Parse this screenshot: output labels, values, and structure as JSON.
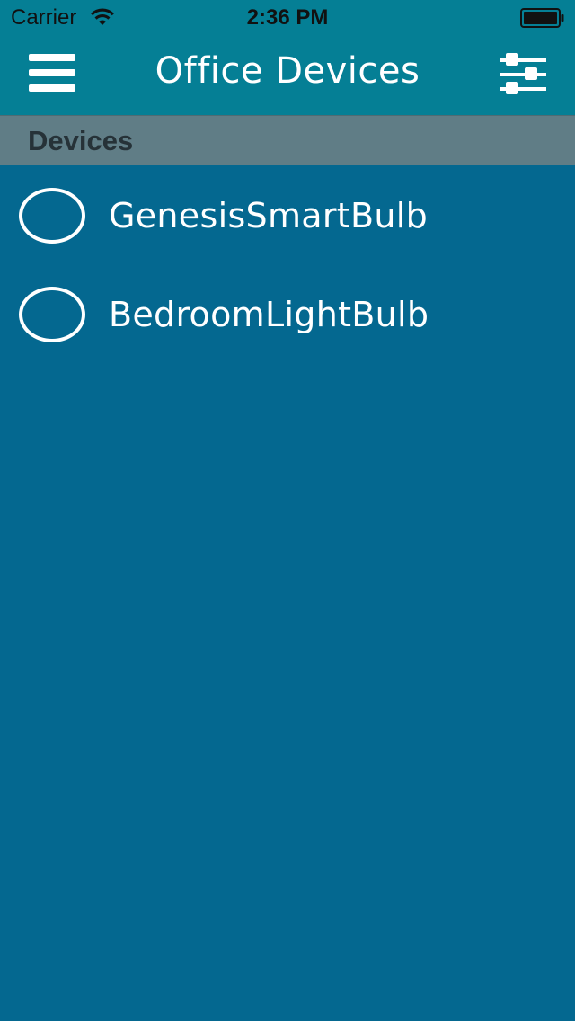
{
  "status_bar": {
    "carrier": "Carrier",
    "time": "2:36 PM",
    "wifi_icon": "wifi-icon",
    "battery_icon": "battery-icon"
  },
  "nav": {
    "title": "Office Devices",
    "menu_icon": "hamburger-menu-icon",
    "filter_icon": "sliders-icon"
  },
  "section": {
    "label": "Devices"
  },
  "devices": [
    {
      "name": "GenesisSmartBulb",
      "selected": false
    },
    {
      "name": "BedroomLightBulb",
      "selected": false
    }
  ],
  "colors": {
    "nav_background": "#057F95",
    "section_background": "#607D86",
    "list_background": "#046890",
    "text_light": "#FFFFFF",
    "text_dark": "#263238"
  }
}
